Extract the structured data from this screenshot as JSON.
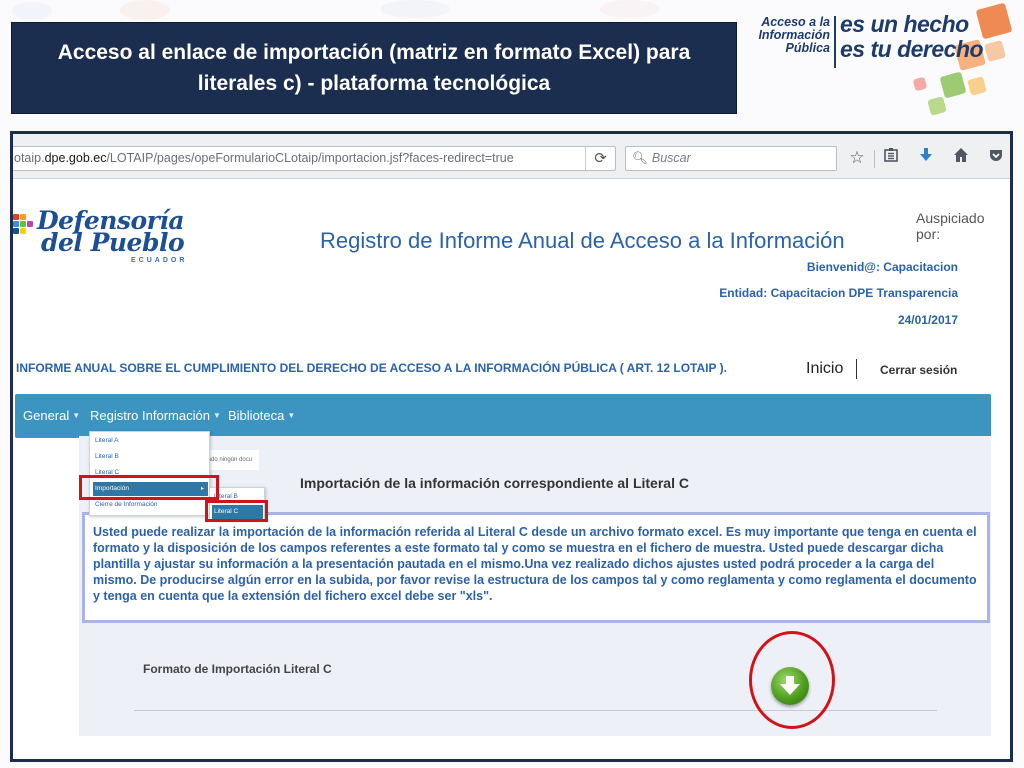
{
  "slide": {
    "title": "Acceso al enlace de importación (matriz en formato Excel) para literales c) - plataforma tecnológica"
  },
  "campaign_logo": {
    "line1": "Acceso a la",
    "line2": "Información",
    "line3": "Pública",
    "slogan1": "es un hecho",
    "slogan2": "es tu derecho"
  },
  "browser": {
    "url_prefix": "otaip.",
    "url_host": "dpe.gob.ec",
    "url_path": "/LOTAIP/pages/opeFormularioCLotaip/importacion.jsf?faces-redirect=true",
    "search_placeholder": "Buscar",
    "icons": [
      "reload-icon",
      "search-icon",
      "star-icon",
      "reading-list-icon",
      "download-icon",
      "home-icon",
      "pocket-icon"
    ]
  },
  "site": {
    "logo_line1": "Defensoría",
    "logo_line2": "del Pueblo",
    "logo_line3": "ECUADOR",
    "sponsor_label": "Auspiciado por:",
    "title": "Registro de Informe Anual de Acceso a la Información",
    "welcome": "Bienvenid@: Capacitacion",
    "entity": "Entidad: Capacitacion DPE Transparencia",
    "date": "24/01/2017",
    "report_title": "INFORME ANUAL SOBRE EL CUMPLIMIENTO DEL DERECHO DE ACCESO A LA INFORMACIÓN PÚBLICA ( ART. 12 LOTAIP ).",
    "home_link": "Inicio",
    "logout_link": "Cerrar sesión"
  },
  "nav": {
    "items": [
      {
        "label": "General"
      },
      {
        "label": "Registro Información"
      },
      {
        "label": "Biblioteca"
      }
    ]
  },
  "menu": {
    "level1": [
      {
        "label": "Literal A"
      },
      {
        "label": "Literal B"
      },
      {
        "label": "Literal C"
      },
      {
        "label": "Importación"
      },
      {
        "label": "Cierre de Información"
      }
    ],
    "level2": [
      {
        "label": "Literal B"
      },
      {
        "label": "Literal C"
      }
    ],
    "hidden_text": "tado ningún docu"
  },
  "content": {
    "import_title": "Importación de la información correspondiente al Literal C",
    "description": "Usted puede realizar la importación de la información referida al Literal C desde un archivo formato excel. Es muy importante que tenga en cuenta el formato y la disposición de los campos referentes a este formato tal y como se muestra en el fichero de muestra. Usted puede descargar dicha plantilla y ajustar su información a la presentación pautada en el mismo.Una vez realizado dichos ajustes usted podrá proceder a la carga del mismo. De producirse algún error en la subida, por favor revise la estructura de los campos tal y como reglamenta y como reglamenta el documento y tenga en cuenta que la extensión del fichero excel debe ser \"xls\".",
    "format_label": "Formato de Importación Literal C"
  },
  "colors": {
    "banner": "#1b2e4f",
    "nav": "#3b95c0",
    "link_blue": "#2a62ad",
    "highlight_red": "#d0141a",
    "download_green": "#4f9e1e"
  }
}
